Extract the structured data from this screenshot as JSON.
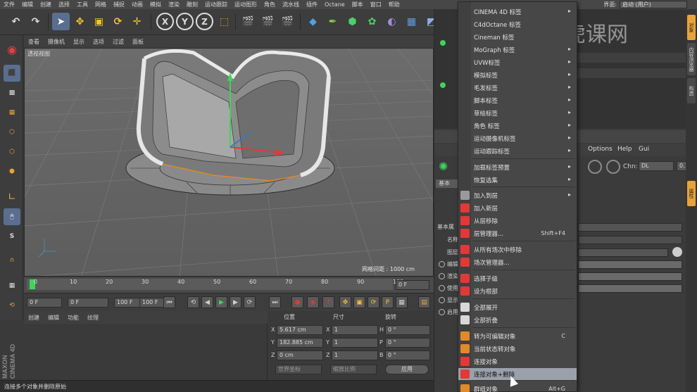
{
  "menubar": {
    "items": [
      "文件",
      "编辑",
      "创建",
      "选择",
      "工具",
      "网格",
      "捕捉",
      "动画",
      "模拟",
      "渲染",
      "雕刻",
      "运动跟踪",
      "运动图形",
      "角色",
      "流水线",
      "插件",
      "Octane",
      "脚本",
      "窗口",
      "帮助"
    ],
    "layout_label": "界面:",
    "layout_value": "启动 (用户)"
  },
  "toolbar": {
    "x_label": "X",
    "y_label": "Y",
    "z_label": "Z"
  },
  "viewport": {
    "menu": [
      "查看",
      "摄像机",
      "显示",
      "选项",
      "过滤",
      "面板"
    ],
    "label": "透视视图",
    "grid_spacing": "网格间距 : 1000 cm"
  },
  "timeline": {
    "ticks": [
      "0",
      "10",
      "20",
      "30",
      "40",
      "50",
      "60",
      "70",
      "80",
      "90",
      "100"
    ],
    "current_frame": "0 F"
  },
  "playback": {
    "start": "0 F",
    "min": "0 F",
    "max_inner": "100 F",
    "max": "100 F"
  },
  "material_manager": {
    "menu": [
      "创建",
      "编辑",
      "功能",
      "纹理"
    ]
  },
  "coordinates": {
    "headers": [
      "位置",
      "尺寸",
      "旋转"
    ],
    "rows": [
      {
        "axis": "X",
        "pos": "5.617 cm",
        "size_axis": "X",
        "size": "1",
        "rot_axis": "H",
        "rot": "0 °"
      },
      {
        "axis": "Y",
        "pos": "182.885 cm",
        "size_axis": "Y",
        "size": "1",
        "rot_axis": "P",
        "rot": "0 °"
      },
      {
        "axis": "Z",
        "pos": "0 cm",
        "size_axis": "Z",
        "size": "1",
        "rot_axis": "B",
        "rot": "0 °"
      }
    ],
    "world_select": "世界坐标",
    "scale_select": "缩放比例",
    "apply": "应用"
  },
  "logo": {
    "line1": "MAXON",
    "line2": "CINEMA 4D"
  },
  "status": {
    "text": "连接多个对象并删除原始"
  },
  "attributes": {
    "menu_partial": [
      "e",
      "Options",
      "Help",
      "Gui"
    ],
    "chn_label": "Chn:",
    "chn_value": "DL",
    "value": "0.1",
    "tab_basic": "基本",
    "row_label_1": "基本属",
    "row_label_2": "名称",
    "row_label_3": "图层",
    "opts": [
      "编辑",
      "渲染",
      "使用",
      "显示",
      "启用"
    ]
  },
  "right_tabs": [
    "对象",
    "内容浏览器",
    "构造",
    "属性"
  ],
  "context_menu": {
    "items": [
      {
        "label": "CINEMA 4D 标签",
        "arrow": true
      },
      {
        "label": "C4dOctane 标签",
        "arrow": false
      },
      {
        "label": "Cineman 标签",
        "arrow": false
      },
      {
        "label": "MoGraph 标签",
        "arrow": true
      },
      {
        "label": "UVW标签",
        "arrow": true
      },
      {
        "label": "模拟标签",
        "arrow": true
      },
      {
        "label": "毛发标签",
        "arrow": true
      },
      {
        "label": "脚本标签",
        "arrow": true
      },
      {
        "label": "草绘标签",
        "arrow": true
      },
      {
        "label": "角色 标签",
        "arrow": true
      },
      {
        "label": "运动摄像机标签",
        "arrow": true
      },
      {
        "label": "运动跟踪标签",
        "arrow": true
      },
      {
        "label": "加载标签预置",
        "arrow": true
      },
      {
        "label": "恢复选集",
        "arrow": true
      },
      {
        "label": "加入到层",
        "arrow": true
      },
      {
        "label": "加入新层",
        "arrow": false
      },
      {
        "label": "从层移除",
        "arrow": false
      },
      {
        "label": "层管理器...",
        "shortcut": "Shift+F4"
      },
      {
        "label": "从所有场次中移除",
        "arrow": false
      },
      {
        "label": "场次管理器...",
        "arrow": false
      },
      {
        "label": "选择子级",
        "arrow": false
      },
      {
        "label": "设为根部",
        "arrow": false
      },
      {
        "label": "全部展开",
        "arrow": false
      },
      {
        "label": "全部折叠",
        "arrow": false
      },
      {
        "label": "转为可编辑对象",
        "shortcut": "C"
      },
      {
        "label": "当前状态转对象",
        "arrow": false
      },
      {
        "label": "连接对象",
        "arrow": false
      },
      {
        "label": "连接对象+删除",
        "arrow": false
      },
      {
        "label": "群组对象",
        "shortcut": "Alt+G"
      }
    ]
  },
  "watermark": {
    "text": "虎课网"
  },
  "colors": {
    "accent_blue": "#3a78c8",
    "highlight": "#9aa1ab",
    "object_orange": "#e08a2a"
  }
}
